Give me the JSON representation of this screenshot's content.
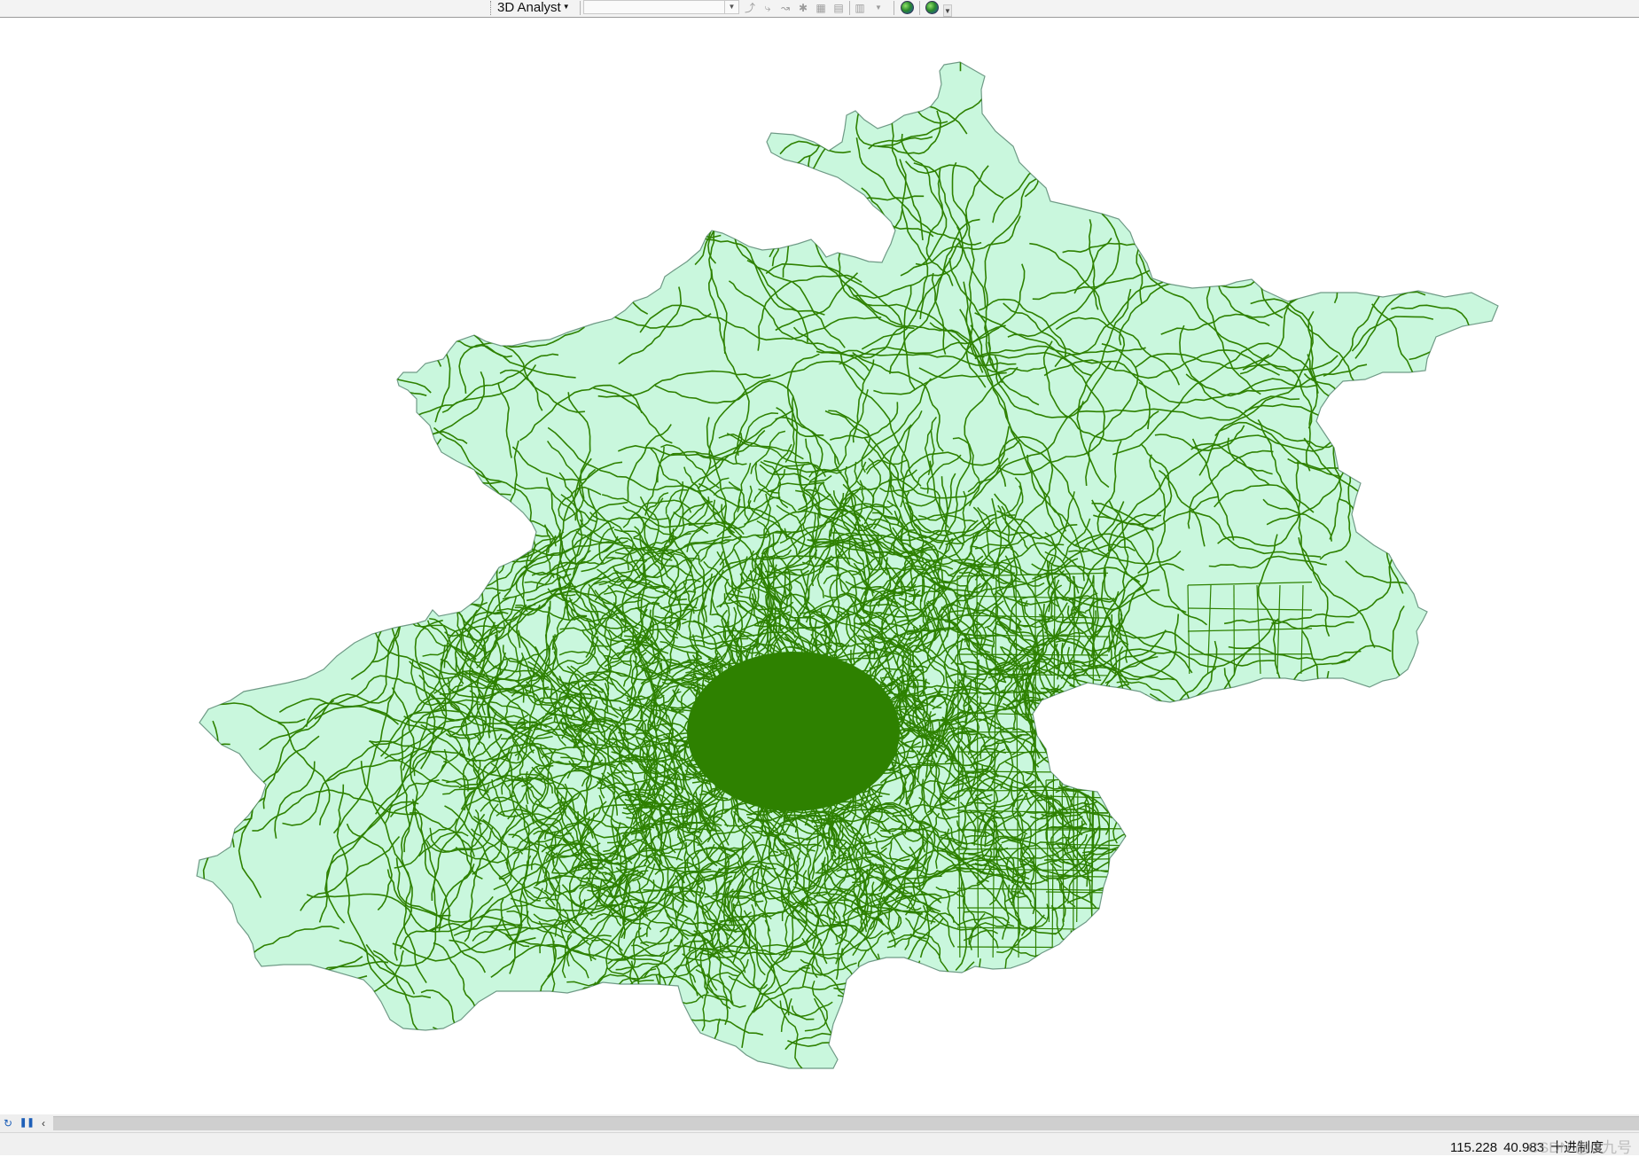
{
  "toolbar": {
    "menu_label": "3D Analyst",
    "layer_combo_value": "",
    "tool_icons": [
      "interpolate-line-icon",
      "steepest-path-icon",
      "line-of-sight-icon",
      "interpolate-point-icon",
      "interpolate-polygon-icon",
      "profile-graph-icon",
      "create-graph-icon"
    ],
    "launch_icons": [
      "arcscene-icon",
      "arcglobe-icon"
    ]
  },
  "map": {
    "fill_color": "#c9f7dd",
    "boundary_color": "#6f9a86",
    "road_color": "#2e8100",
    "layers": [
      "boundary-polygon",
      "road-network"
    ]
  },
  "nav": {
    "refresh_icon": "refresh-icon",
    "pause_icon": "pause-icon",
    "scroll_left_icon": "scroll-left-icon"
  },
  "status": {
    "x_coordinate": "115.228",
    "y_coordinate": "40.983",
    "units": "十进制度",
    "watermark": "CSDN @G九号"
  }
}
